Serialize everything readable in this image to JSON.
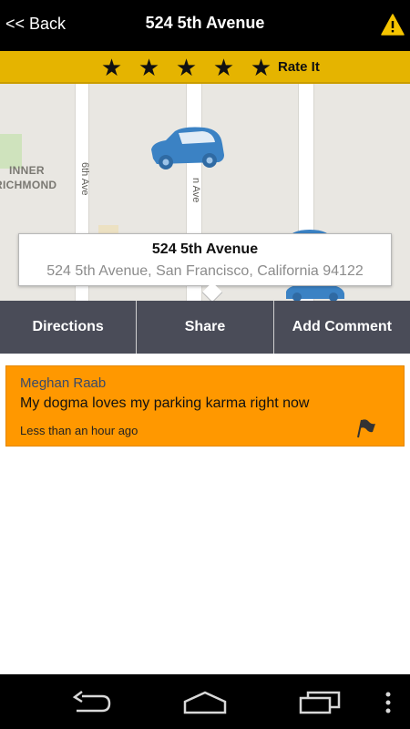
{
  "header": {
    "back_label": "<< Back",
    "title": "524 5th Avenue",
    "warning_icon": "warning-icon"
  },
  "rating": {
    "stars": [
      "★",
      "★",
      "★",
      "★",
      "★"
    ],
    "rate_label": "Rate It"
  },
  "map": {
    "area_label_line1": "INNER",
    "area_label_line2": "RICHMOND",
    "street_1": "6th Ave",
    "street_2": "n Ave"
  },
  "callout": {
    "title": "524 5th Avenue",
    "address": "524 5th Avenue, San Francisco, California 94122"
  },
  "actions": {
    "directions": "Directions",
    "share": "Share",
    "add_comment": "Add Comment"
  },
  "comments": [
    {
      "author": "Meghan Raab",
      "text": "My dogma loves my parking karma right now",
      "time": "Less than an hour ago",
      "flag_icon": "flag-icon"
    }
  ],
  "navbar": {
    "back_icon": "back-arrow-icon",
    "home_icon": "home-icon",
    "recents_icon": "recent-apps-icon",
    "menu_icon": "overflow-menu-icon"
  },
  "colors": {
    "rating_bar": "#e5b400",
    "comment_bg": "#ff9800",
    "action_bar": "#4a4c58",
    "car": "#3b82c4"
  }
}
